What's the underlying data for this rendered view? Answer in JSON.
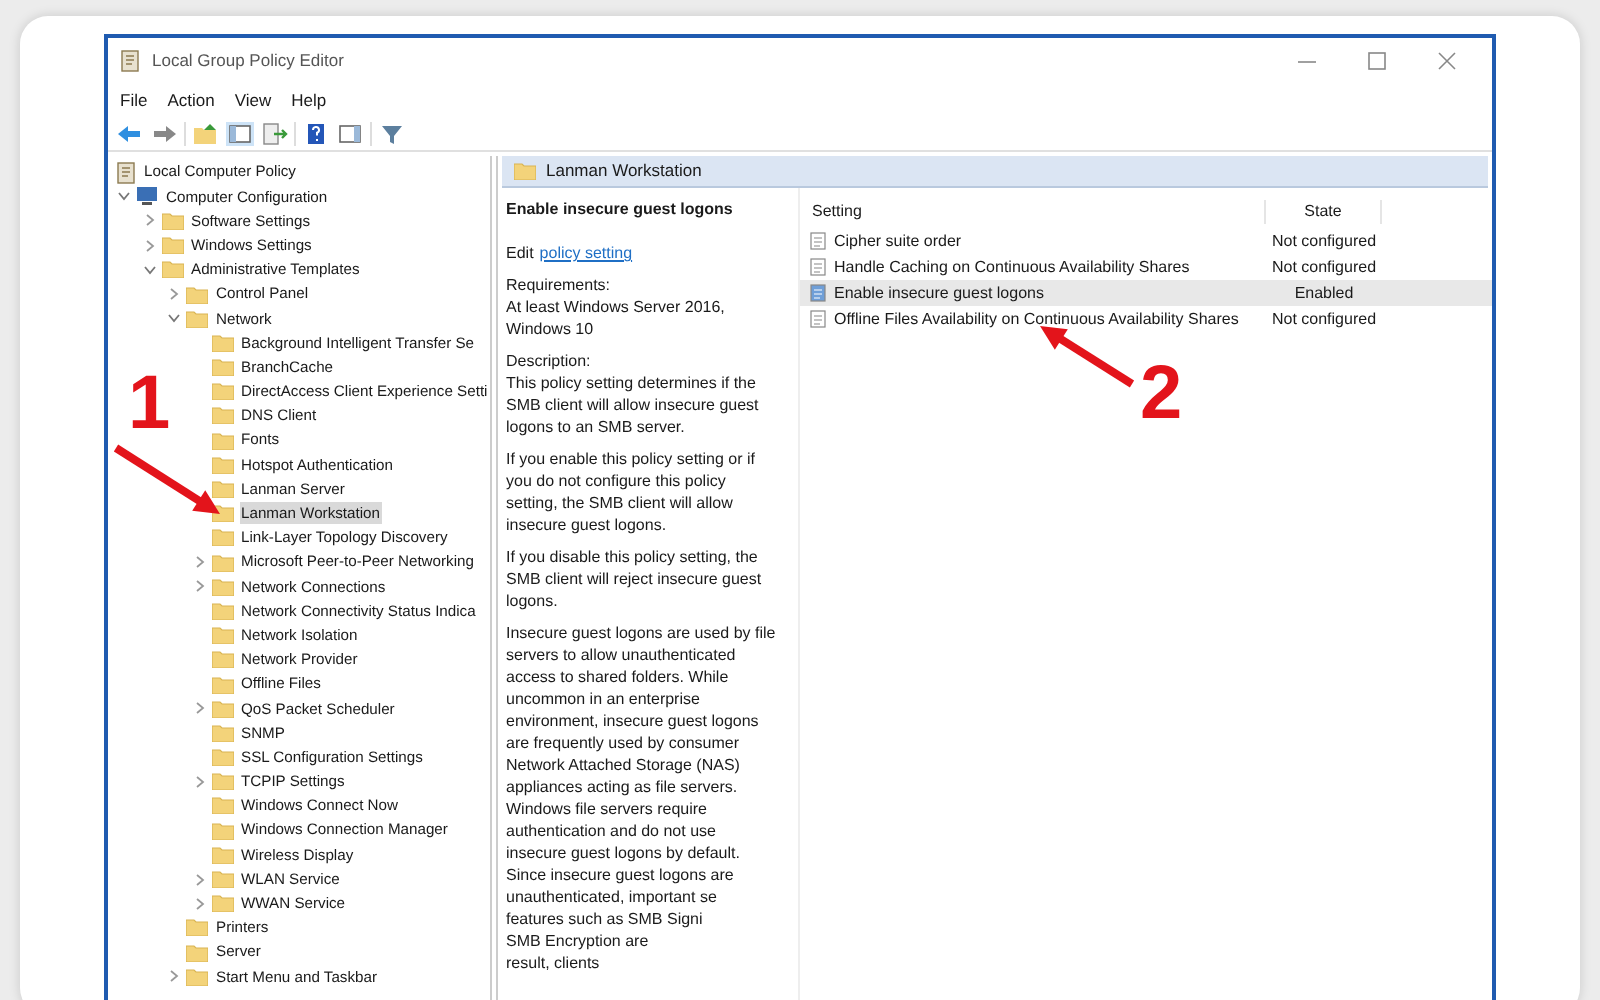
{
  "window": {
    "title": "Local Group Policy Editor"
  },
  "menu": [
    "File",
    "Action",
    "View",
    "Help"
  ],
  "tree": [
    {
      "label": "Local Computer Policy",
      "kind": "policy",
      "selected": false,
      "children": [
        {
          "label": "Computer Configuration",
          "kind": "computer",
          "expanded": true,
          "selected": false,
          "children": [
            {
              "label": "Software Settings",
              "kind": "folder",
              "expanded": false,
              "selected": false
            },
            {
              "label": "Windows Settings",
              "kind": "folder",
              "expanded": false,
              "selected": false
            },
            {
              "label": "Administrative Templates",
              "kind": "folder",
              "expanded": true,
              "selected": false,
              "children": [
                {
                  "label": "Control Panel",
                  "kind": "folder",
                  "expanded": false,
                  "selected": false
                },
                {
                  "label": "Network",
                  "kind": "folder",
                  "expanded": true,
                  "selected": false,
                  "children": [
                    {
                      "label": "Background Intelligent Transfer Se",
                      "kind": "folder",
                      "selected": false
                    },
                    {
                      "label": "BranchCache",
                      "kind": "folder",
                      "selected": false
                    },
                    {
                      "label": "DirectAccess Client Experience Setti",
                      "kind": "folder",
                      "selected": false
                    },
                    {
                      "label": "DNS Client",
                      "kind": "folder",
                      "selected": false
                    },
                    {
                      "label": "Fonts",
                      "kind": "folder",
                      "selected": false
                    },
                    {
                      "label": "Hotspot Authentication",
                      "kind": "folder",
                      "selected": false
                    },
                    {
                      "label": "Lanman Server",
                      "kind": "folder",
                      "selected": false
                    },
                    {
                      "label": "Lanman Workstation",
                      "kind": "folder",
                      "selected": true
                    },
                    {
                      "label": "Link-Layer Topology Discovery",
                      "kind": "folder",
                      "selected": false
                    },
                    {
                      "label": "Microsoft Peer-to-Peer Networking",
                      "kind": "folder",
                      "expanded": false,
                      "selected": false
                    },
                    {
                      "label": "Network Connections",
                      "kind": "folder",
                      "expanded": false,
                      "selected": false
                    },
                    {
                      "label": "Network Connectivity Status Indica",
                      "kind": "folder",
                      "selected": false
                    },
                    {
                      "label": "Network Isolation",
                      "kind": "folder",
                      "selected": false
                    },
                    {
                      "label": "Network Provider",
                      "kind": "folder",
                      "selected": false
                    },
                    {
                      "label": "Offline Files",
                      "kind": "folder",
                      "selected": false
                    },
                    {
                      "label": "QoS Packet Scheduler",
                      "kind": "folder",
                      "expanded": false,
                      "selected": false
                    },
                    {
                      "label": "SNMP",
                      "kind": "folder",
                      "selected": false
                    },
                    {
                      "label": "SSL Configuration Settings",
                      "kind": "folder",
                      "selected": false
                    },
                    {
                      "label": "TCPIP Settings",
                      "kind": "folder",
                      "expanded": false,
                      "selected": false
                    },
                    {
                      "label": "Windows Connect Now",
                      "kind": "folder",
                      "selected": false
                    },
                    {
                      "label": "Windows Connection Manager",
                      "kind": "folder",
                      "selected": false
                    },
                    {
                      "label": "Wireless Display",
                      "kind": "folder",
                      "selected": false
                    },
                    {
                      "label": "WLAN Service",
                      "kind": "folder",
                      "expanded": false,
                      "selected": false
                    },
                    {
                      "label": "WWAN Service",
                      "kind": "folder",
                      "expanded": false,
                      "selected": false
                    }
                  ]
                },
                {
                  "label": "Printers",
                  "kind": "folder",
                  "selected": false
                },
                {
                  "label": "Server",
                  "kind": "folder",
                  "selected": false
                },
                {
                  "label": "Start Menu and Taskbar",
                  "kind": "folder",
                  "expanded": false,
                  "selected": false
                }
              ]
            }
          ]
        }
      ]
    }
  ],
  "detail": {
    "header": "Lanman Workstation",
    "title": "Enable insecure guest logons",
    "edit_prefix": "Edit",
    "edit_link": "policy setting",
    "paragraphs": [
      {
        "lines": [
          "Requirements:",
          "At least Windows Server 2016,",
          "Windows 10"
        ]
      },
      {
        "lines": [
          "Description:",
          "This policy setting determines if the",
          "SMB client will allow insecure guest",
          "logons to an SMB server."
        ]
      },
      {
        "lines": [
          "If you enable this policy setting or if",
          "you do not configure this policy",
          "setting, the SMB client will allow",
          "insecure guest logons."
        ]
      },
      {
        "lines": [
          "If you disable this policy setting, the",
          "SMB client will reject insecure guest",
          "logons."
        ]
      },
      {
        "lines": [
          "Insecure guest logons are used by file",
          "servers to allow unauthenticated",
          "access to shared folders. While",
          "uncommon in an enterprise",
          "environment, insecure guest logons",
          "are frequently used by consumer",
          "Network Attached Storage (NAS)",
          "appliances acting as file servers.",
          "Windows file servers require",
          "authentication and do not use",
          "insecure guest logons by default.",
          "Since insecure guest logons are",
          "unauthenticated, important se",
          "features such as SMB Signi",
          "SMB Encryption are",
          "result, clients"
        ]
      }
    ]
  },
  "settings_table": {
    "columns": [
      "Setting",
      "State"
    ],
    "rows": [
      {
        "setting": "Cipher suite order",
        "state": "Not configured",
        "selected": false
      },
      {
        "setting": "Handle Caching on Continuous Availability Shares",
        "state": "Not configured",
        "selected": false
      },
      {
        "setting": "Enable insecure guest logons",
        "state": "Enabled",
        "selected": true
      },
      {
        "setting": "Offline Files Availability on Continuous Availability Shares",
        "state": "Not configured",
        "selected": false
      }
    ]
  },
  "annotations": [
    {
      "label": "1"
    },
    {
      "label": "2"
    }
  ]
}
